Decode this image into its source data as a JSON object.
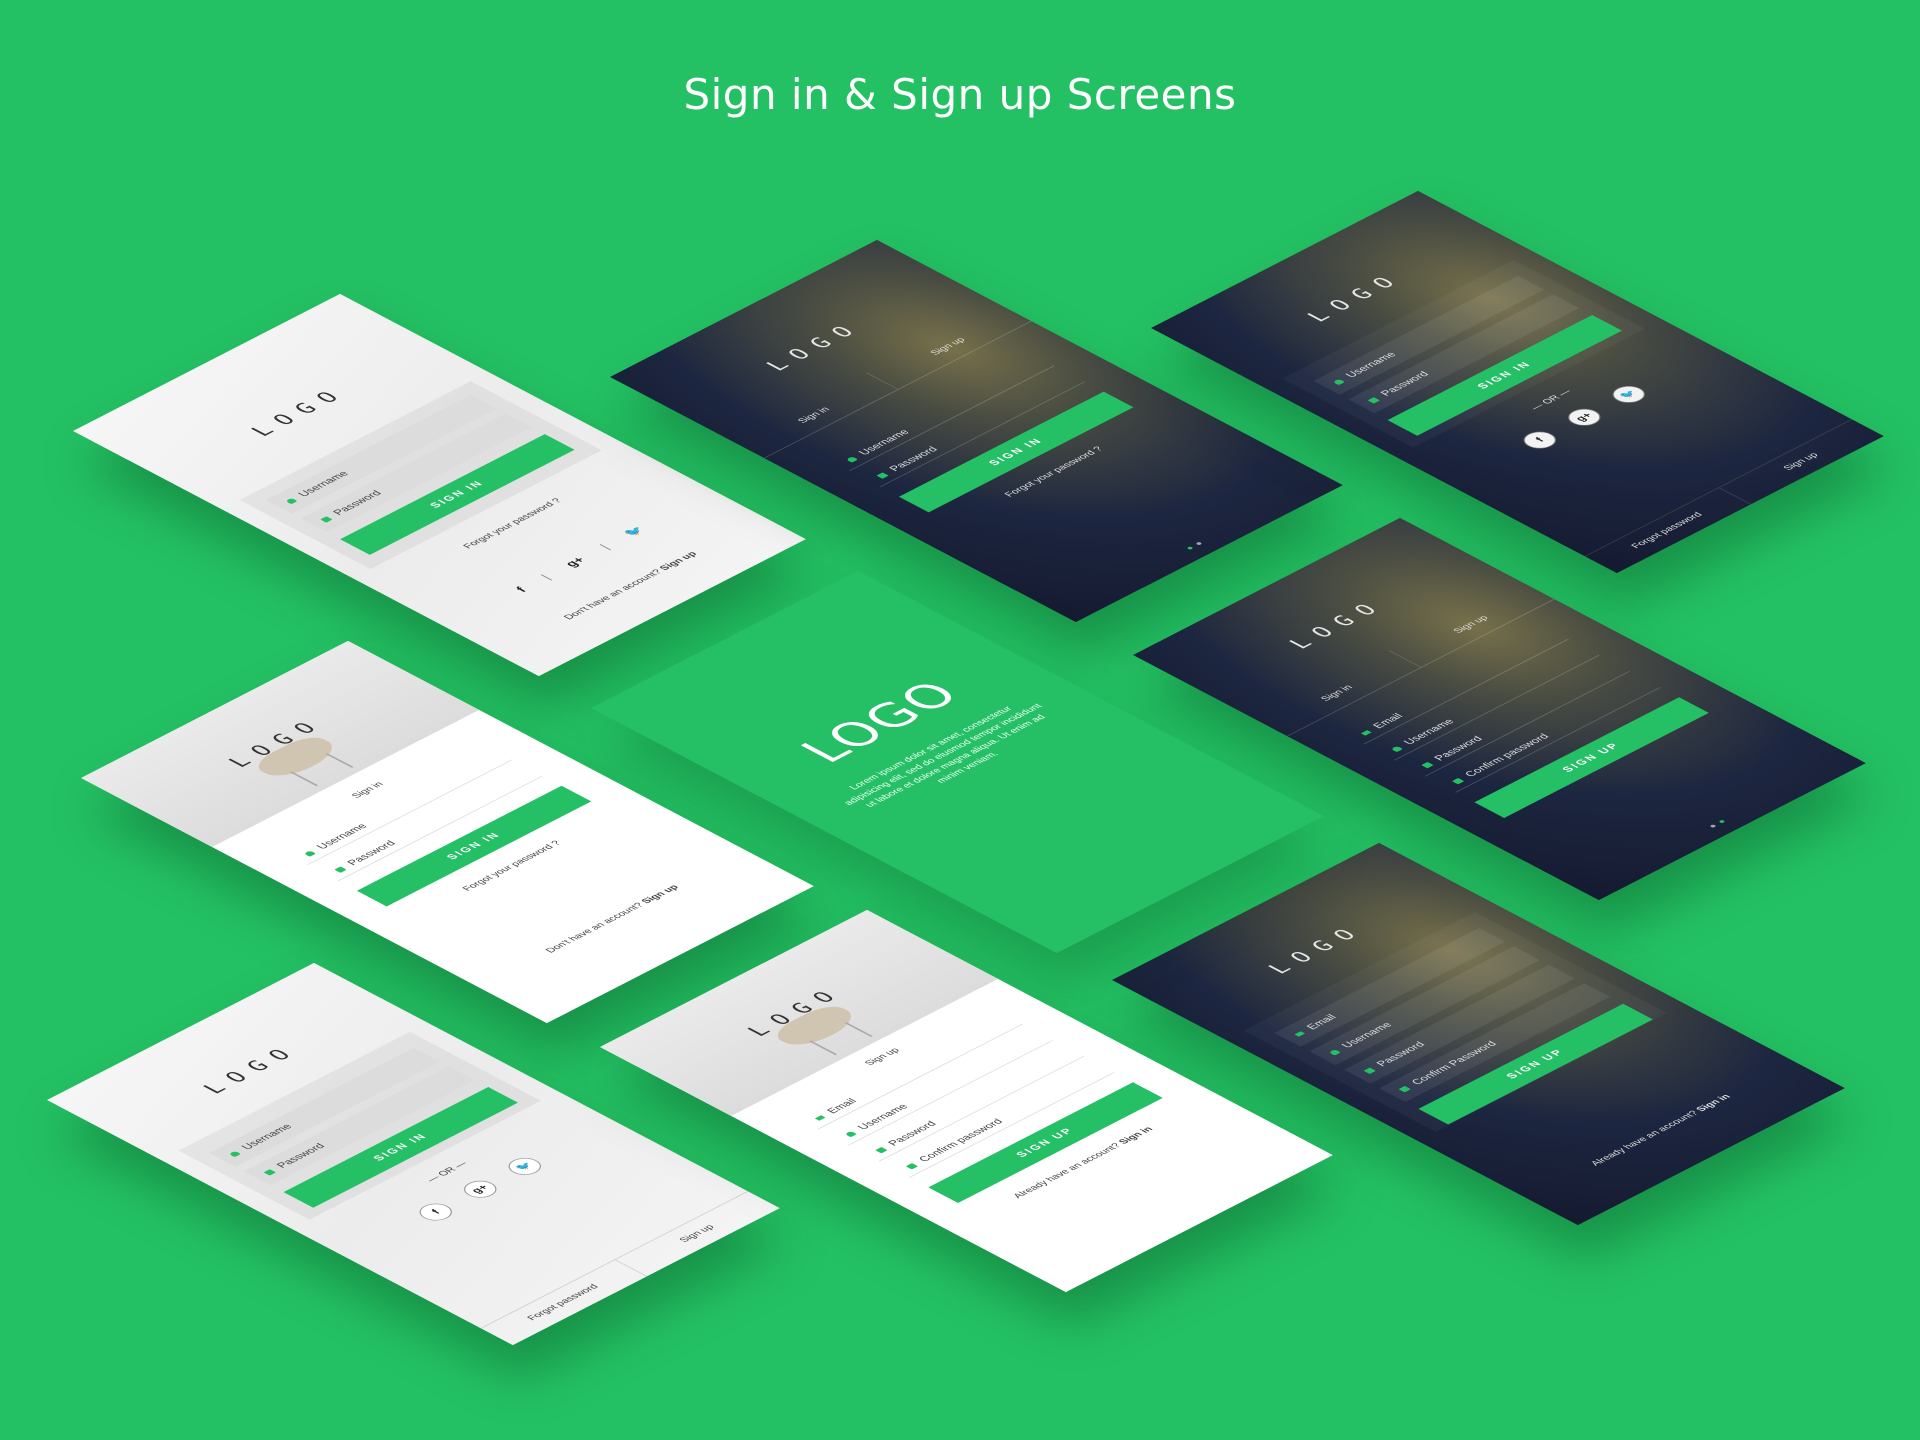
{
  "title": "Sign in & Sign up Screens",
  "colors": {
    "background": "#24c164",
    "accent": "#25c066",
    "dark": "#141a30"
  },
  "s1": {
    "logo": "LOGO",
    "username": "Username",
    "password": "Password",
    "button": "SIGN IN",
    "forgot": "Forgot your password ?",
    "social": {
      "facebook": "f",
      "google": "g+",
      "twitter": "🐦",
      "sep": "|"
    },
    "prompt": "Don't have an account?",
    "link": "Sign up"
  },
  "s2": {
    "logo": "LOGO",
    "tab_signin": "Sign in",
    "tab_signup": "Sign up",
    "username": "Username",
    "password": "Password",
    "button": "SIGN IN",
    "forgot": "Forgot your password ?"
  },
  "s3": {
    "logo": "LOGO",
    "username": "Username",
    "password": "Password",
    "button": "SIGN IN",
    "or": "— OR —",
    "social": {
      "facebook": "f",
      "google": "g+",
      "twitter": "🐦"
    },
    "forgot": "Forgot password",
    "signup": "Sign up"
  },
  "s4": {
    "logo": "LOGO",
    "tab_signin": "Sign in",
    "tab_signup": "Sign up",
    "email": "Email",
    "username": "Username",
    "password": "Password",
    "confirm": "Confirm password",
    "button": "SIGN UP"
  },
  "s5": {
    "logo": "LOGO",
    "email": "Email",
    "username": "Username",
    "password": "Password",
    "confirm": "Confirm Password",
    "button": "SIGN UP",
    "prompt": "Already have an account?",
    "link": "Sign in"
  },
  "s6": {
    "logo": "LOGO",
    "description": "Lorem ipsum dolor sit amet, consectetur adipisicing elit, sed do eiusmod tempor incididunt ut labore et dolore magna aliqua. Ut enim ad minim veniam."
  },
  "s7": {
    "logo": "LOGO",
    "heading": "Sign in",
    "username": "Username",
    "password": "Password",
    "button": "SIGN IN",
    "forgot": "Forgot your password ?",
    "prompt": "Don't have an account?",
    "link": "Sign up"
  },
  "s8": {
    "logo": "LOGO",
    "username": "Username",
    "password": "Password",
    "button": "SIGN IN",
    "or": "— OR —",
    "social": {
      "facebook": "f",
      "google": "g+",
      "twitter": "🐦"
    },
    "forgot": "Forgot password",
    "signup": "Sign up"
  },
  "s9": {
    "logo": "LOGO",
    "heading": "Sign up",
    "email": "Email",
    "username": "Username",
    "password": "Password",
    "confirm": "Confirm password",
    "button": "SIGN UP",
    "prompt": "Already have an account?",
    "link": "Sign in"
  }
}
